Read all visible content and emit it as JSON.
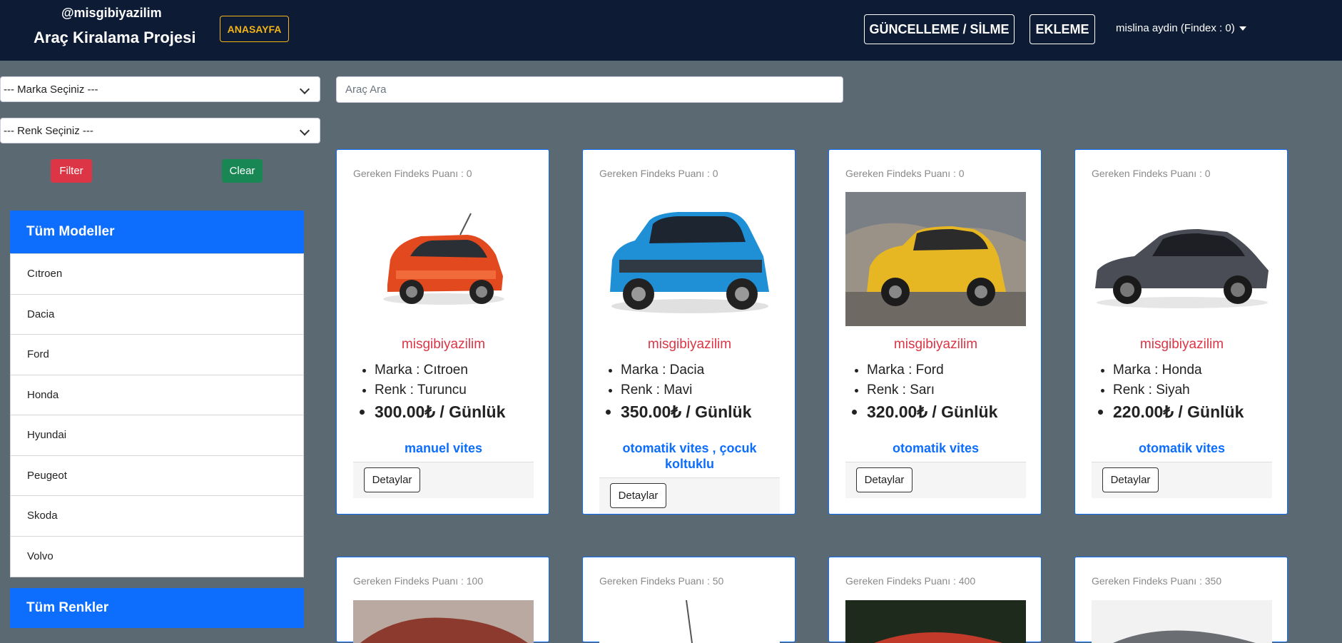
{
  "navbar": {
    "handle": "@misgibiyazilim",
    "title": "Araç Kiralama Projesi",
    "home_label": "ANASAYFA",
    "update_delete_label": "GÜNCELLEME / SİLME",
    "add_label": "EKLEME",
    "user_label": "mislina aydin (Findex : 0)"
  },
  "filters": {
    "brand_select": "--- Marka Seçiniz ---",
    "color_select": "--- Renk Seçiniz ---",
    "filter_label": "Filter",
    "clear_label": "Clear",
    "search_placeholder": "Araç Ara"
  },
  "sidebar": {
    "brands_title": "Tüm Modeller",
    "brands": [
      "Cıtroen",
      "Dacia",
      "Ford",
      "Honda",
      "Hyundai",
      "Peugeot",
      "Skoda",
      "Volvo"
    ],
    "colors_title": "Tüm Renkler"
  },
  "cars": [
    {
      "findex": "Gereken Findeks Puanı : 0",
      "owner": "misgibiyazilim",
      "brand": "Marka : Cıtroen",
      "color": "Renk : Turuncu",
      "price": "300.00₺ / Günlük",
      "desc": "manuel vites",
      "detail": "Detaylar"
    },
    {
      "findex": "Gereken Findeks Puanı : 0",
      "owner": "misgibiyazilim",
      "brand": "Marka : Dacia",
      "color": "Renk : Mavi",
      "price": "350.00₺ / Günlük",
      "desc": "otomatik vites , çocuk koltuklu",
      "detail": "Detaylar"
    },
    {
      "findex": "Gereken Findeks Puanı : 0",
      "owner": "misgibiyazilim",
      "brand": "Marka : Ford",
      "color": "Renk : Sarı",
      "price": "320.00₺ / Günlük",
      "desc": "otomatik vites",
      "detail": "Detaylar"
    },
    {
      "findex": "Gereken Findeks Puanı : 0",
      "owner": "misgibiyazilim",
      "brand": "Marka : Honda",
      "color": "Renk : Siyah",
      "price": "220.00₺ / Günlük",
      "desc": "otomatik vites",
      "detail": "Detaylar"
    }
  ],
  "cars_row2": [
    {
      "findex": "Gereken Findeks Puanı : 100"
    },
    {
      "findex": "Gereken Findeks Puanı : 50"
    },
    {
      "findex": "Gereken Findeks Puanı : 400"
    },
    {
      "findex": "Gereken Findeks Puanı : 350"
    }
  ],
  "colors": {
    "navbar_bg": "#0d1b35",
    "page_bg": "#5b6a72",
    "primary": "#0d6efd",
    "danger": "#dc3545",
    "success": "#198754",
    "warning": "#f3b319"
  }
}
